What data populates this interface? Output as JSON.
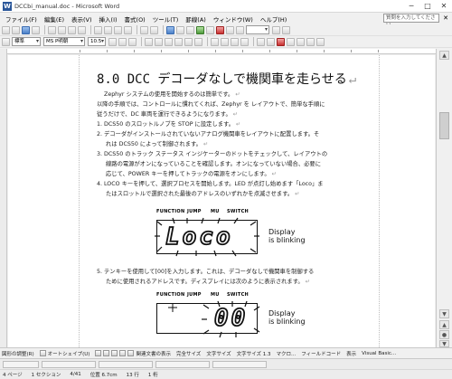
{
  "window": {
    "title": "DCCbi_manual.doc - Microsoft Word",
    "app_icon_letter": "W",
    "minimize": "─",
    "maximize": "□",
    "close": "✕"
  },
  "menubar": {
    "items": [
      "ファイル(F)",
      "編集(E)",
      "表示(V)",
      "挿入(I)",
      "書式(O)",
      "ツール(T)",
      "罫線(A)",
      "ウィンドウ(W)",
      "ヘルプ(H)"
    ],
    "help_placeholder": "質問を入力してください",
    "help_close": "✕"
  },
  "toolbar2": {
    "style": "標準",
    "font": "MS P明朝",
    "size": "10.5"
  },
  "document": {
    "heading": "8.0 DCC デコーダなしで機関車を走らせる",
    "p1": "Zephyr システムの使用を開始するのは簡単です。",
    "p2a": "以降の手順では、コントロールに慣れてくれば、Zephyr を レイアウトで、簡単な手順に",
    "p2b": "従うだけで、DC 車両を運行できるようになります。",
    "s1": "1. DCS50 のスロットルノブを STOP に設定します。",
    "s2a": "2. デコーダがインストールされていないアナログ機関車をレイアウトに配置します。そ",
    "s2b": "れは DCS50 によって制御されます。",
    "s3a": "3. DCS50 のトラック ステータス インジケーターのドットをチェックして、レイアウトの",
    "s3b": "線路の電源がオンになっていることを確認します。オンになっていない場合、必要に",
    "s3c": "応じて、POWER キーを押してトラックの電源をオンにします。",
    "s4a": "4. LOCO キーを押して、選択プロセスを開始します。LED が点灯し始めます「Loco」ま",
    "s4b": "たはスロットルで選択された最後のアドレスのいずれかを点滅させます。",
    "s5a": "5. テンキーを使用して[00]を入力します。これは、デコーダなしで機関車を制御する",
    "s5b": "ために使用されるアドレスです。ディスプレイには次のように表示されます。",
    "para_mark": "↵",
    "loco_key": "LOCO",
    "power_key": "POWER",
    "loco_word": "「Loco」",
    "zero_key": "[00]"
  },
  "panel1": {
    "labels": [
      "FUNCTION",
      "JUMP",
      "MU",
      "SWITCH"
    ],
    "display": "Loco",
    "caption_line1": "Display",
    "caption_line2": "is blinking"
  },
  "panel2": {
    "labels": [
      "FUNCTION",
      "JUMP",
      "MU",
      "SWITCH"
    ],
    "display": "00",
    "caption_line1": "Display",
    "caption_line2": "is blinking"
  },
  "bottom_toolbar": {
    "items": [
      "図形の調整(R)",
      "オートシェイプ(U)",
      "",
      "",
      "",
      "",
      "",
      "関連文書の表示",
      "完全サイズ",
      "文字サイズ",
      "文字サイズ 1.3",
      "マクロ...",
      "フィールドコード",
      "表示",
      "Visual Basic..."
    ]
  },
  "statusbar": {
    "page": "4 ページ",
    "section": "1 セクション",
    "pages": "4/41",
    "position": "位置 6.7cm",
    "line": "13 行",
    "col": "1 桁"
  },
  "colors": {
    "accent": "#2b579a",
    "link_blue": "#2040c0"
  }
}
